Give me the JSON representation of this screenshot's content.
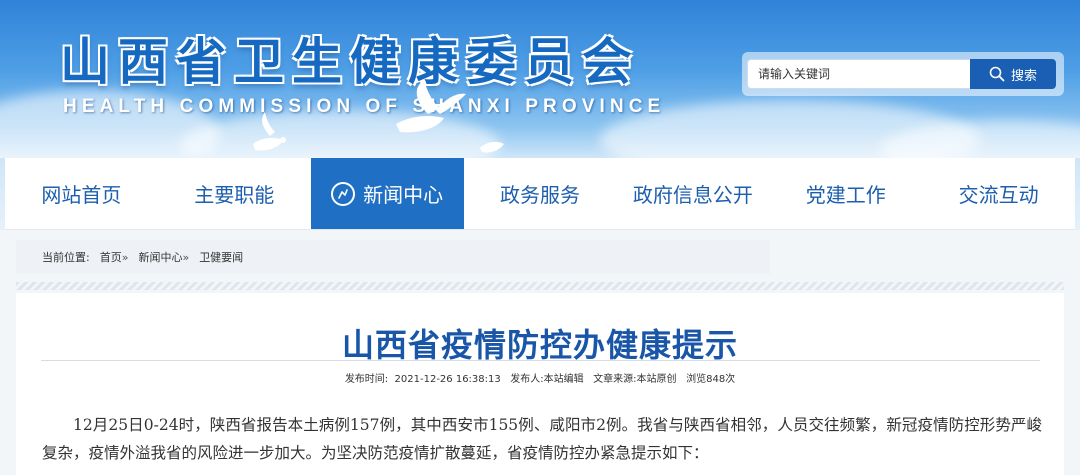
{
  "header": {
    "title": "山西省卫生健康委员会",
    "subtitle": "HEALTH COMMISSION OF SHANXI PROVINCE"
  },
  "search": {
    "placeholder": "请输入关键词",
    "button_label": "搜索"
  },
  "nav": {
    "items": [
      {
        "label": "网站首页"
      },
      {
        "label": "主要职能"
      },
      {
        "label": "新闻中心"
      },
      {
        "label": "政务服务"
      },
      {
        "label": "政府信息公开"
      },
      {
        "label": "党建工作"
      },
      {
        "label": "交流互动"
      }
    ],
    "active_color": "#1f6fc4"
  },
  "breadcrumb": {
    "prefix": "当前位置:",
    "items": [
      "首页",
      "新闻中心",
      "卫健要闻"
    ],
    "separator": "»"
  },
  "article": {
    "title": "山西省疫情防控办健康提示",
    "meta": "发布时间:  2021-12-26 16:38:13   发布人:本站编辑   文章来源:本站原创   浏览848次",
    "body": "12月25日0-24时，陕西省报告本土病例157例，其中西安市155例、咸阳市2例。我省与陕西省相邻，人员交往频繁，新冠疫情防控形势严峻复杂，疫情外溢我省的风险进一步加大。为坚决防范疫情扩散蔓延，省疫情防控办紧急提示如下："
  },
  "colors": {
    "brand_blue": "#1a56a8",
    "nav_text": "#1d5fae",
    "search_button": "#1a5fb3"
  }
}
